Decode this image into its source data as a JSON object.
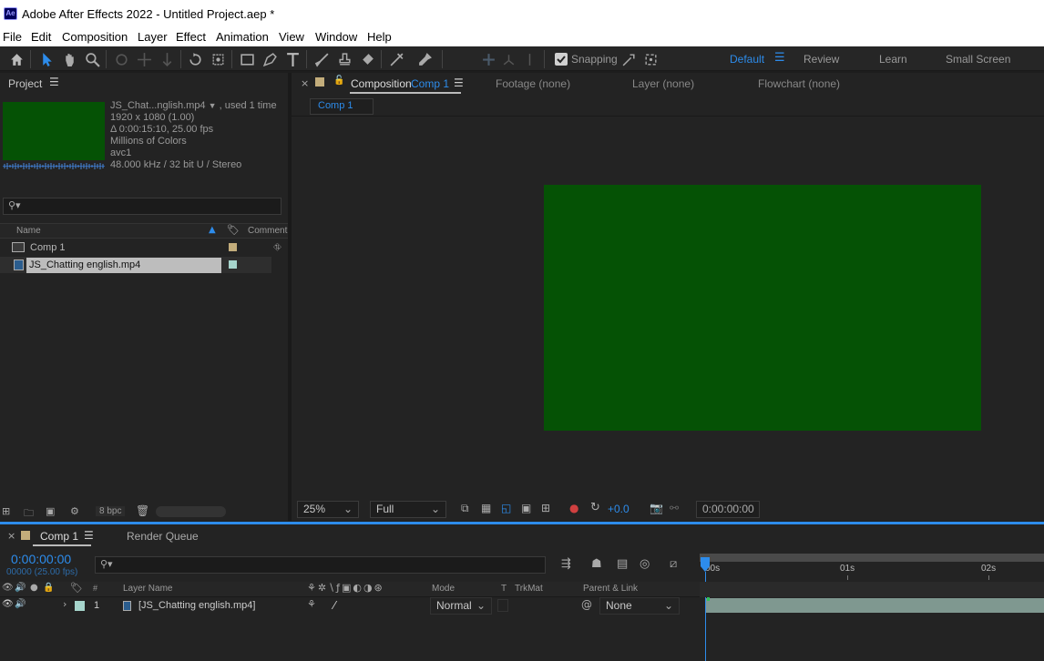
{
  "window": {
    "title": "Adobe After Effects 2022 - Untitled Project.aep *",
    "app_icon": "Ae"
  },
  "menu": [
    "File",
    "Edit",
    "Composition",
    "Layer",
    "Effect",
    "Animation",
    "View",
    "Window",
    "Help"
  ],
  "toolbar": {
    "snapping_label": "Snapping",
    "workspaces": [
      "Default",
      "Review",
      "Learn",
      "Small Screen"
    ],
    "active_workspace": "Default"
  },
  "project": {
    "tab": "Project",
    "item_name": "JS_Chat...nglish.mp4",
    "used": ", used 1 time",
    "info": [
      "1920 x 1080 (1.00)",
      "Δ 0:00:15:10, 25.00 fps",
      "Millions of Colors",
      "avc1",
      "48.000 kHz / 32 bit U / Stereo"
    ],
    "search_placeholder": "",
    "columns": {
      "name": "Name",
      "comment": "Comment"
    },
    "items": [
      {
        "name": "Comp 1",
        "label_color": "#c3ad7b"
      },
      {
        "name": "JS_Chatting english.mp4",
        "label_color": "#a6d5cc"
      }
    ],
    "bpc": "8 bpc"
  },
  "composition": {
    "tabs": [
      {
        "prefix": "Composition",
        "name": "Comp 1"
      },
      {
        "prefix": "Footage",
        "name": "(none)"
      },
      {
        "prefix": "Layer",
        "name": "(none)"
      },
      {
        "prefix": "Flowchart",
        "name": "(none)"
      }
    ],
    "breadcrumb": "Comp 1",
    "canvas_color": "#055205",
    "zoom": "25%",
    "resolution": "Full",
    "exposure": "+0.0",
    "timecode": "0:00:00:00"
  },
  "timeline": {
    "tab": "Comp 1",
    "render_queue": "Render Queue",
    "timecode": "0:00:00:00",
    "frame_info": "00000 (25.00 fps)",
    "columns": {
      "num": "#",
      "layer_name": "Layer Name",
      "mode": "Mode",
      "t": "T",
      "trkmat": "TrkMat",
      "parent": "Parent & Link"
    },
    "ruler": [
      "00s",
      "01s",
      "02s"
    ],
    "layers": [
      {
        "num": "1",
        "name": "[JS_Chatting english.mp4]",
        "mode": "Normal",
        "parent": "None",
        "label_color": "#a6d5cc"
      }
    ]
  }
}
